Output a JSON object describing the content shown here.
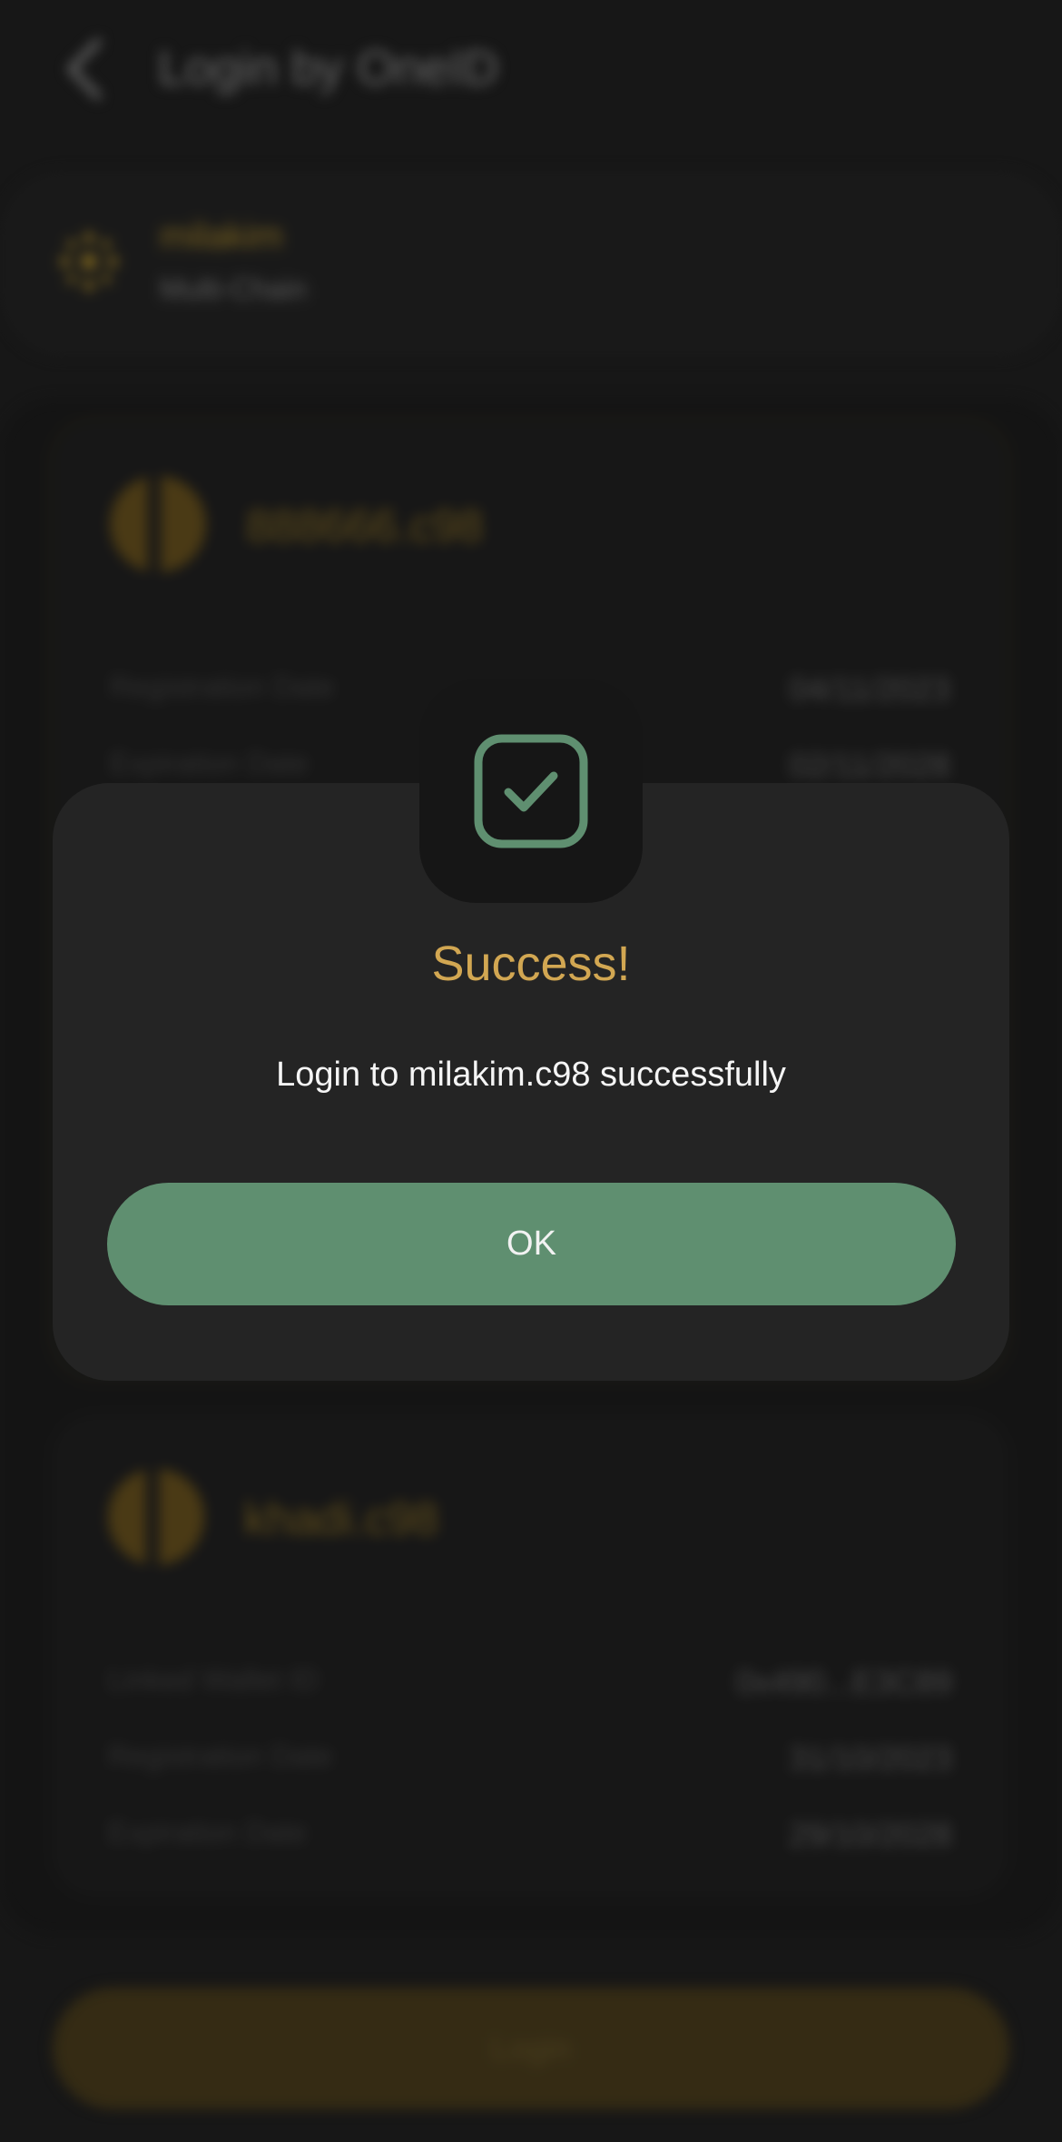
{
  "header": {
    "title": "Login by OneID",
    "back_icon": "chevron-left-icon"
  },
  "account": {
    "name": "milakim",
    "chain": "Multi-Chain",
    "icon": "network-dots-icon"
  },
  "id_cards": [
    {
      "name": "888666.c98",
      "rows": [
        {
          "label": "Registration Date",
          "value": "04/11/2023"
        },
        {
          "label": "Expiration Date",
          "value": "02/11/2028"
        }
      ]
    },
    {
      "name": "khadi.c98",
      "rows": [
        {
          "label": "Linked Wallet ID",
          "value": "0x490...E3C89"
        },
        {
          "label": "Registration Date",
          "value": "31/10/2023"
        },
        {
          "label": "Expiration Date",
          "value": "29/10/2028"
        }
      ]
    }
  ],
  "login_button": {
    "label": "Login"
  },
  "modal": {
    "icon": "check-square-icon",
    "title": "Success!",
    "message": "Login to milakim.c98 successfully",
    "ok_label": "OK"
  },
  "colors": {
    "accent_gold": "#d2a752",
    "success_green": "#5f8f70",
    "background": "#222222"
  }
}
